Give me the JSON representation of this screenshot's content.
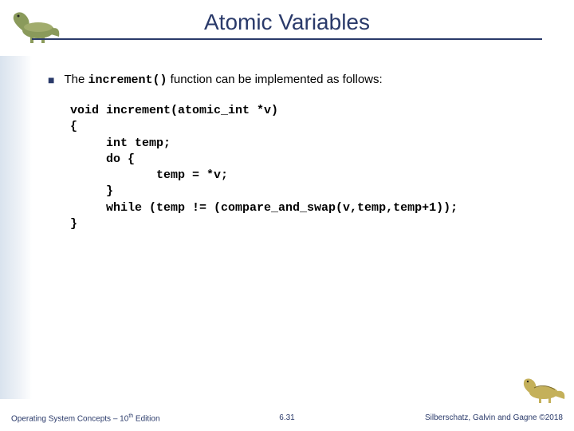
{
  "header": {
    "title": "Atomic Variables"
  },
  "bullet": {
    "text_before": "The ",
    "code": "increment()",
    "text_after": " function can be implemented as follows:"
  },
  "code": "void increment(atomic_int *v)\n{\n     int temp;\n     do {\n            temp = *v;\n     }\n     while (temp != (compare_and_swap(v,temp,temp+1));\n}",
  "footer": {
    "left_prefix": "Operating System Concepts – 10",
    "left_sup": "th",
    "left_suffix": " Edition",
    "center": "6.31",
    "right": "Silberschatz, Galvin and Gagne ©2018"
  },
  "icons": {
    "dino_left": "dinosaur-icon",
    "dino_right": "dinosaur-icon"
  }
}
